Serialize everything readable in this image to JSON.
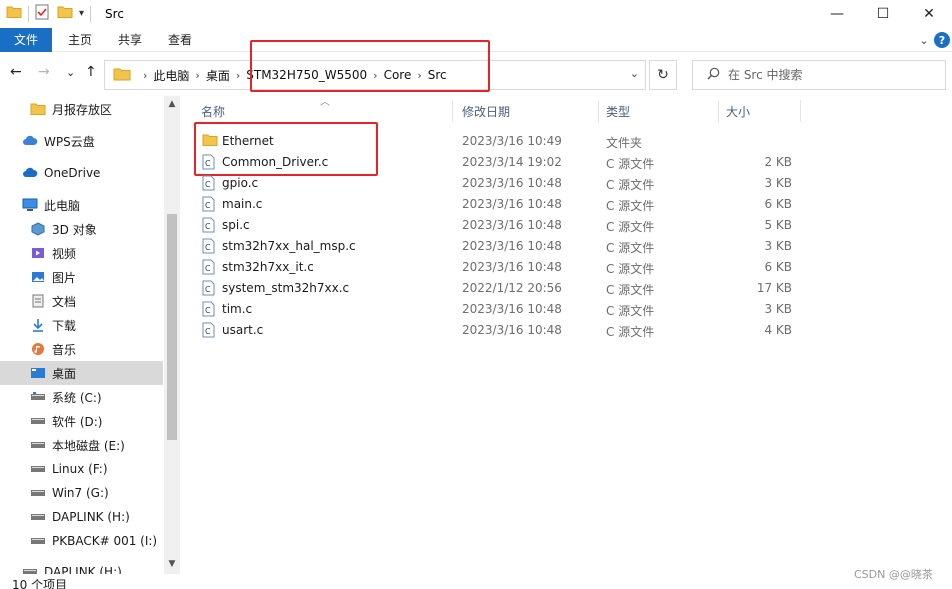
{
  "window": {
    "title": "Src",
    "minimize": "—",
    "maximize": "☐",
    "close": "✕"
  },
  "ribbon": {
    "tabs": [
      "文件",
      "主页",
      "共享",
      "查看"
    ]
  },
  "navigation": {
    "back": "←",
    "forward": "→",
    "recent": "⌄",
    "up": "↑",
    "breadcrumb": [
      "此电脑",
      "桌面",
      "STM32H750_W5500",
      "Core",
      "Src"
    ],
    "refresh": "↻"
  },
  "search": {
    "placeholder": "在 Src 中搜索"
  },
  "sidebar": {
    "items": [
      {
        "label": "月报存放区",
        "icon": "folder-icon"
      },
      {
        "label": "WPS云盘",
        "icon": "cloud-icon"
      },
      {
        "label": "OneDrive",
        "icon": "cloud-icon"
      },
      {
        "label": "此电脑",
        "icon": "computer-icon"
      },
      {
        "label": "3D 对象",
        "icon": "cube-icon"
      },
      {
        "label": "视频",
        "icon": "video-icon"
      },
      {
        "label": "图片",
        "icon": "picture-icon"
      },
      {
        "label": "文档",
        "icon": "document-icon"
      },
      {
        "label": "下载",
        "icon": "download-icon"
      },
      {
        "label": "音乐",
        "icon": "music-icon"
      },
      {
        "label": "桌面",
        "icon": "desktop-icon",
        "selected": true
      },
      {
        "label": "系统 (C:)",
        "icon": "drive-icon"
      },
      {
        "label": "软件 (D:)",
        "icon": "drive-icon"
      },
      {
        "label": "本地磁盘 (E:)",
        "icon": "drive-icon"
      },
      {
        "label": "Linux (F:)",
        "icon": "drive-icon"
      },
      {
        "label": "Win7 (G:)",
        "icon": "drive-icon"
      },
      {
        "label": "DAPLINK (H:)",
        "icon": "drive-icon"
      },
      {
        "label": "PKBACK# 001 (I:)",
        "icon": "drive-icon"
      },
      {
        "label": "DAPLINK (H:)",
        "icon": "drive-icon"
      }
    ]
  },
  "columns": {
    "name": "名称",
    "date": "修改日期",
    "type": "类型",
    "size": "大小"
  },
  "files": [
    {
      "name": "Ethernet",
      "date": "2023/3/16 10:49",
      "type": "文件夹",
      "size": "",
      "kind": "folder"
    },
    {
      "name": "Common_Driver.c",
      "date": "2023/3/14 19:02",
      "type": "C 源文件",
      "size": "2 KB",
      "kind": "c"
    },
    {
      "name": "gpio.c",
      "date": "2023/3/16 10:48",
      "type": "C 源文件",
      "size": "3 KB",
      "kind": "c"
    },
    {
      "name": "main.c",
      "date": "2023/3/16 10:48",
      "type": "C 源文件",
      "size": "6 KB",
      "kind": "c"
    },
    {
      "name": "spi.c",
      "date": "2023/3/16 10:48",
      "type": "C 源文件",
      "size": "5 KB",
      "kind": "c"
    },
    {
      "name": "stm32h7xx_hal_msp.c",
      "date": "2023/3/16 10:48",
      "type": "C 源文件",
      "size": "3 KB",
      "kind": "c"
    },
    {
      "name": "stm32h7xx_it.c",
      "date": "2023/3/16 10:48",
      "type": "C 源文件",
      "size": "6 KB",
      "kind": "c"
    },
    {
      "name": "system_stm32h7xx.c",
      "date": "2022/1/12 20:56",
      "type": "C 源文件",
      "size": "17 KB",
      "kind": "c"
    },
    {
      "name": "tim.c",
      "date": "2023/3/16 10:48",
      "type": "C 源文件",
      "size": "3 KB",
      "kind": "c"
    },
    {
      "name": "usart.c",
      "date": "2023/3/16 10:48",
      "type": "C 源文件",
      "size": "4 KB",
      "kind": "c"
    }
  ],
  "status": {
    "count": "10 个项目"
  },
  "watermark": "CSDN @@晓茶",
  "colors": {
    "accent": "#1a6fc4",
    "highlight_box": "#e3242b",
    "folder": "#f3c44c",
    "selection": "#d9d9d9"
  }
}
